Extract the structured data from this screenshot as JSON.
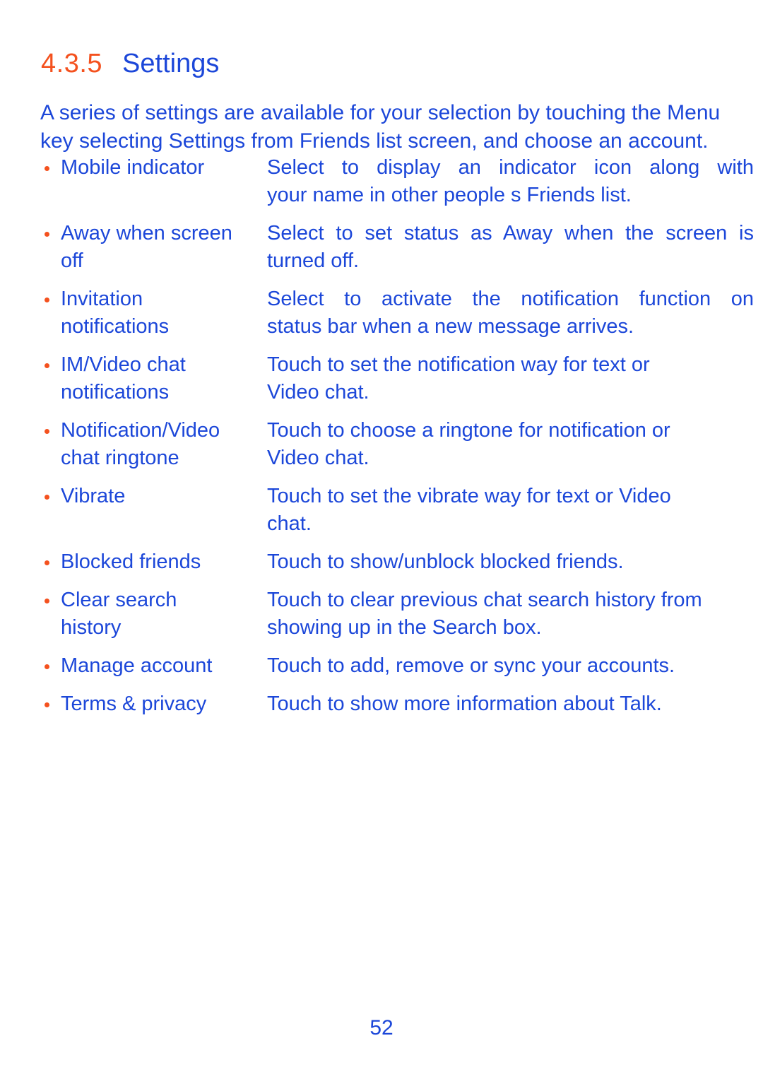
{
  "heading": {
    "number": "4.3.5",
    "title": "Settings"
  },
  "intro": {
    "line1": "A series of settings are available for your selection by touching the Menu",
    "line2": "key selecting Settings from Friends list screen, and choose an account."
  },
  "settings_rows": [
    {
      "term_line1": "Mobile indicator",
      "term_line2": "",
      "desc_line1": "Select to display an indicator icon along with",
      "desc_line2": "your name in other people s Friends list.",
      "justify1": true,
      "justify2": false
    },
    {
      "term_line1": "Away when screen",
      "term_line2": "off",
      "desc_line1": "Select to set status as Away when the screen is",
      "desc_line2": "turned off.",
      "justify1": true,
      "justify2": false
    },
    {
      "term_line1": "Invitation",
      "term_line2": "notifications",
      "desc_line1": "Select to activate the notification function on",
      "desc_line2": "status bar when a new message arrives.",
      "justify1": true,
      "justify2": false
    },
    {
      "term_line1": "IM/Video chat",
      "term_line2": "notifications",
      "desc_line1": "Touch to set the notification way for text or",
      "desc_line2": "Video chat.",
      "justify1": false,
      "justify2": false
    },
    {
      "term_line1": "Notification/Video",
      "term_line2": "chat ringtone",
      "desc_line1": "Touch to choose a ringtone for notification or",
      "desc_line2": "Video chat.",
      "justify1": false,
      "justify2": false
    },
    {
      "term_line1": "Vibrate",
      "term_line2": "",
      "desc_line1": "Touch to set the vibrate way for text or Video",
      "desc_line2": "chat.",
      "justify1": false,
      "justify2": false
    },
    {
      "term_line1": "Blocked friends",
      "term_line2": "",
      "desc_line1": "Touch to show/unblock blocked friends.",
      "desc_line2": "",
      "justify1": false,
      "justify2": false
    },
    {
      "term_line1": "Clear search",
      "term_line2": "history",
      "desc_line1": "Touch to clear previous chat search history from",
      "desc_line2": "showing up in the Search box.",
      "justify1": false,
      "justify2": false
    },
    {
      "term_line1": "Manage account",
      "term_line2": "",
      "desc_line1": "Touch to add, remove or sync your accounts.",
      "desc_line2": "",
      "justify1": false,
      "justify2": false
    },
    {
      "term_line1": "Terms & privacy",
      "term_line2": "",
      "desc_line1": "Touch to show more information about Talk.",
      "desc_line2": "",
      "justify1": false,
      "justify2": false
    }
  ],
  "footer": {
    "page_number": "52"
  },
  "colors": {
    "accent_orange": "#f4511e",
    "text_blue": "#1c47d9",
    "background": "#ffffff"
  }
}
